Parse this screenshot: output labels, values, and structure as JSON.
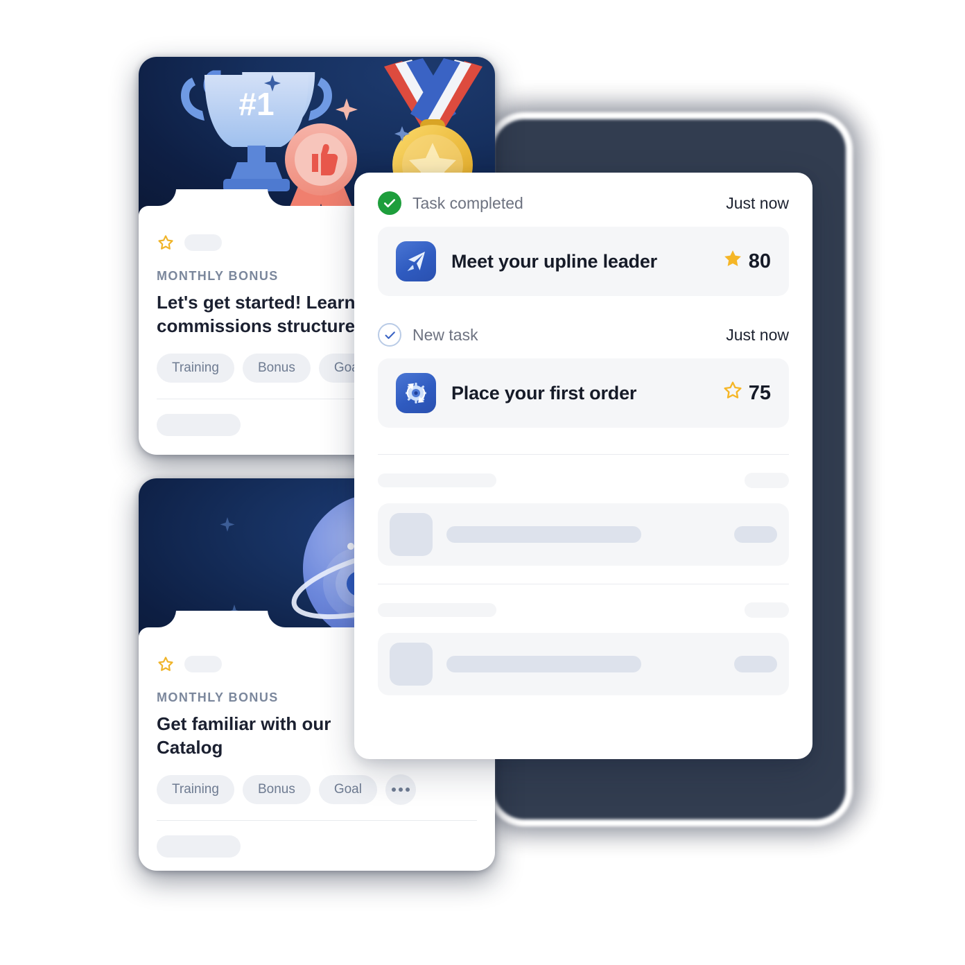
{
  "colors": {
    "accent_blue": "#2f5bc0",
    "success_green": "#1e9e3c",
    "star_gold": "#f5b627",
    "hero_navy": "#0e1f44",
    "shadow_slab": "#2c374b"
  },
  "cards": [
    {
      "eyebrow": "MONTHLY BONUS",
      "title": "Let's get started! Learn our\ncommissions structure",
      "tags": [
        "Training",
        "Bonus",
        "Goal"
      ],
      "more_label": "…",
      "illustration": "trophy-medal-ribbon-illustration"
    },
    {
      "eyebrow": "MONTHLY BONUS",
      "title": "Get familiar with our\nCatalog",
      "tags": [
        "Training",
        "Bonus",
        "Goal"
      ],
      "more_label": "…",
      "illustration": "hand-holding-globe-illustration"
    }
  ],
  "panel": {
    "notifications": [
      {
        "status": "Task completed",
        "status_icon": "check-circle-filled-icon",
        "time": "Just now",
        "task": {
          "name": "Meet your upline leader",
          "icon": "paper-plane-icon",
          "points": "80",
          "points_icon": "star-filled-icon"
        }
      },
      {
        "status": "New task",
        "status_icon": "check-circle-outline-icon",
        "time": "Just now",
        "task": {
          "name": "Place your first order",
          "icon": "gear-refresh-icon",
          "points": "75",
          "points_icon": "star-outline-icon"
        }
      }
    ],
    "skeleton_rows": 2
  }
}
